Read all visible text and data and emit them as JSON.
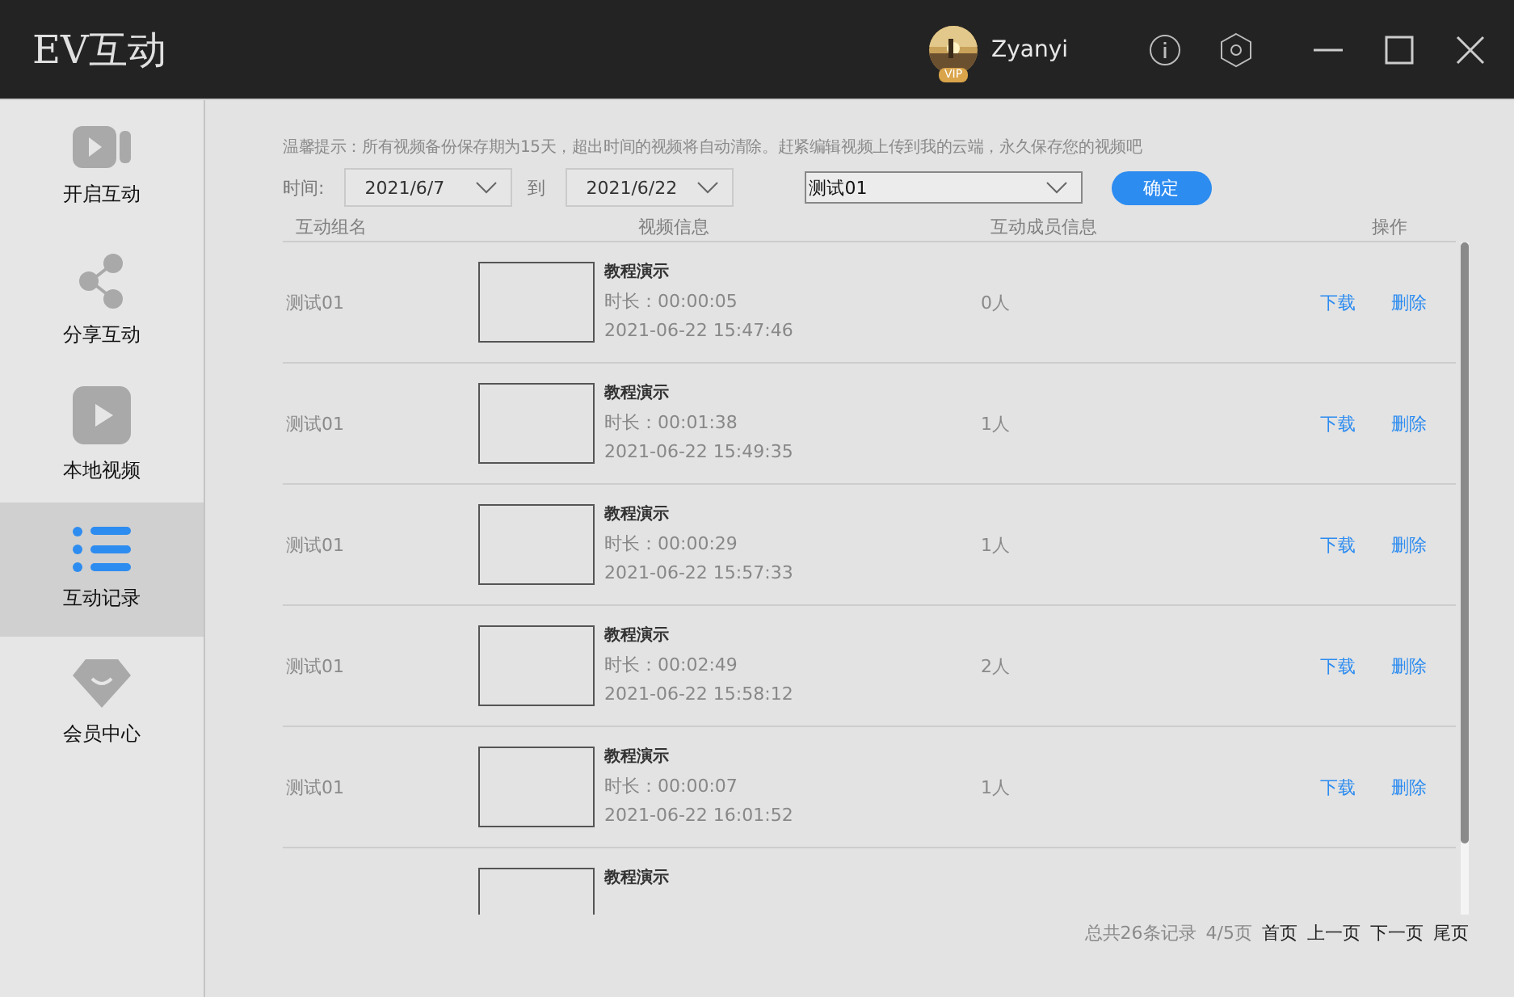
{
  "window": {
    "title": "EV互动",
    "user": {
      "name": "Zyanyi",
      "badge": "VIP"
    }
  },
  "sidebar": {
    "items": [
      {
        "label": "开启互动",
        "kind": "camera",
        "selected": false
      },
      {
        "label": "分享互动",
        "kind": "share",
        "selected": false
      },
      {
        "label": "本地视频",
        "kind": "play",
        "selected": false
      },
      {
        "label": "互动记录",
        "kind": "list",
        "selected": true
      },
      {
        "label": "会员中心",
        "kind": "diamond",
        "selected": false
      }
    ]
  },
  "notice": "温馨提示：所有视频备份保存期为15天，超出时间的视频将自动清除。赶紧编辑视频上传到我的云端，永久保存您的视频吧",
  "filter": {
    "time_label": "时间:",
    "from": "2021/6/7",
    "to_label": "到",
    "to": "2021/6/22",
    "group": "测试01",
    "confirm": "确定"
  },
  "table": {
    "columns": [
      "互动组名",
      "视频信息",
      "互动成员信息",
      "操作"
    ],
    "rows": [
      {
        "group": "测试01",
        "title": "教程演示",
        "duration": "时长：00:00:05",
        "date": "2021-06-22 15:47:46",
        "members": "0人",
        "actions": [
          "下载",
          "删除"
        ]
      },
      {
        "group": "测试01",
        "title": "教程演示",
        "duration": "时长：00:01:38",
        "date": "2021-06-22 15:49:35",
        "members": "1人",
        "actions": [
          "下载",
          "删除"
        ]
      },
      {
        "group": "测试01",
        "title": "教程演示",
        "duration": "时长：00:00:29",
        "date": "2021-06-22 15:57:33",
        "members": "1人",
        "actions": [
          "下载",
          "删除"
        ]
      },
      {
        "group": "测试01",
        "title": "教程演示",
        "duration": "时长：00:02:49",
        "date": "2021-06-22 15:58:12",
        "members": "2人",
        "actions": [
          "下载",
          "删除"
        ]
      },
      {
        "group": "测试01",
        "title": "教程演示",
        "duration": "时长：00:00:07",
        "date": "2021-06-22 16:01:52",
        "members": "1人",
        "actions": [
          "下载",
          "删除"
        ]
      },
      {
        "title": "教程演示"
      }
    ]
  },
  "pagination": {
    "total": "总共26条记录",
    "page": "4/5页",
    "links": [
      "首页",
      "上一页",
      "下一页",
      "尾页"
    ]
  }
}
